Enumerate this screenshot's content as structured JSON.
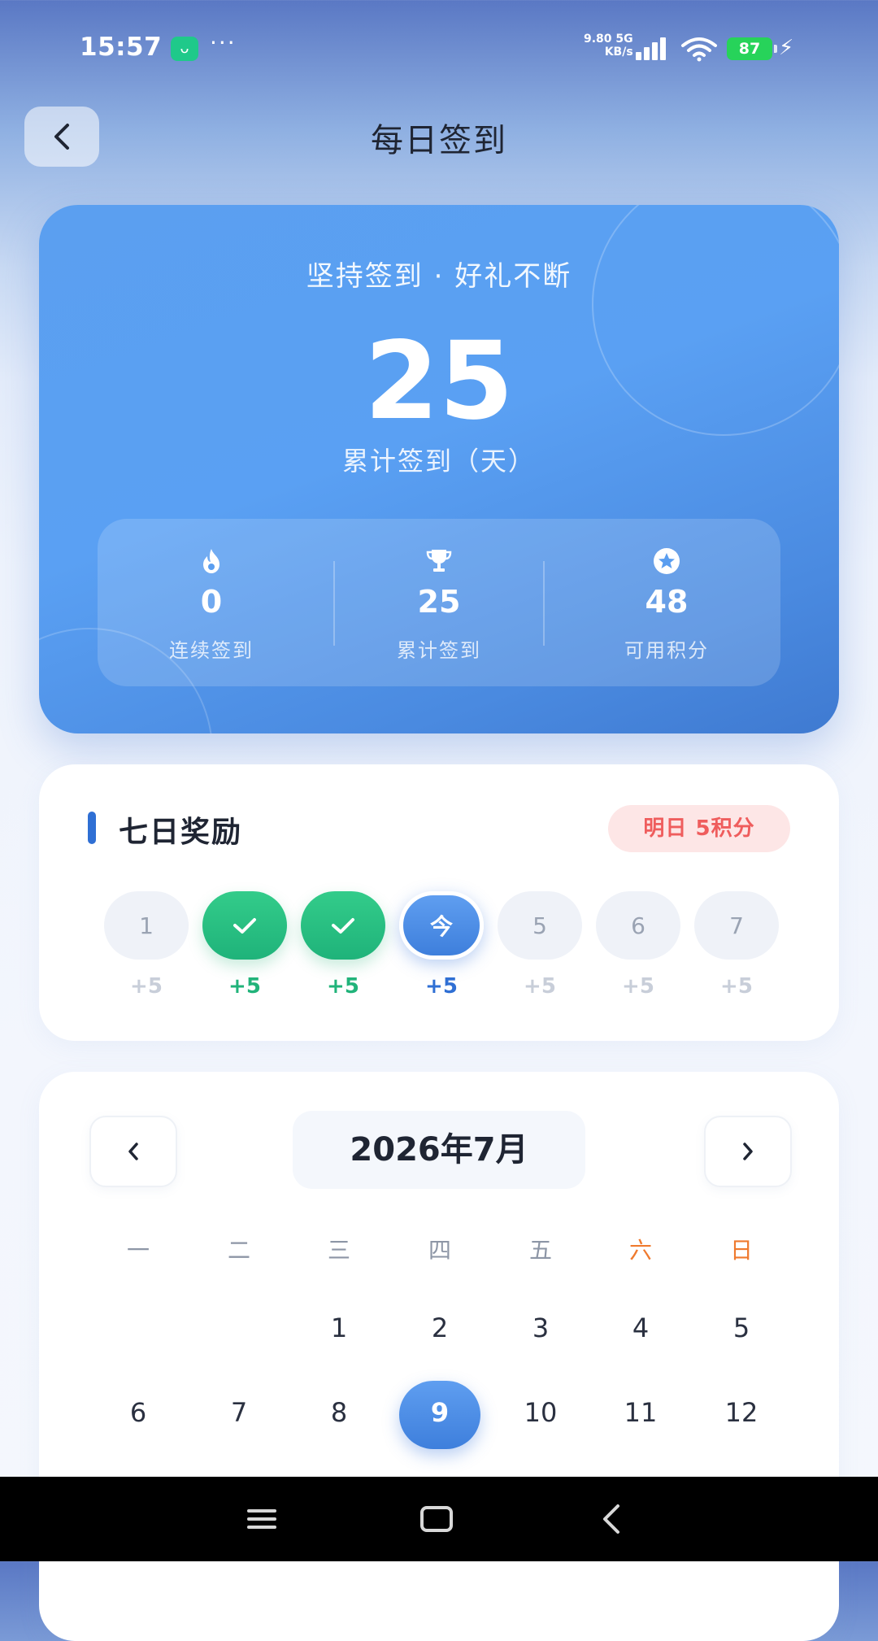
{
  "status_bar": {
    "time": "15:57",
    "app_icon": "mi-app-icon",
    "more": "···",
    "net_speed_value": "9.80 5G",
    "net_speed_unit": "KB/s",
    "battery": "87"
  },
  "header": {
    "title": "每日签到"
  },
  "hero": {
    "slogan": "坚持签到 · 好礼不断",
    "total_days": "25",
    "total_label": "累计签到（天）",
    "stats": [
      {
        "icon": "fire-icon",
        "value": "0",
        "label": "连续签到"
      },
      {
        "icon": "trophy-icon",
        "value": "25",
        "label": "累计签到"
      },
      {
        "icon": "star-badge-icon",
        "value": "48",
        "label": "可用积分"
      }
    ]
  },
  "seven_day": {
    "title": "七日奖励",
    "badge": "明日 5积分",
    "days": [
      {
        "label": "1",
        "points": "+5",
        "state": "future"
      },
      {
        "label": "",
        "points": "+5",
        "state": "done"
      },
      {
        "label": "",
        "points": "+5",
        "state": "done"
      },
      {
        "label": "今",
        "points": "+5",
        "state": "today"
      },
      {
        "label": "5",
        "points": "+5",
        "state": "future"
      },
      {
        "label": "6",
        "points": "+5",
        "state": "future"
      },
      {
        "label": "7",
        "points": "+5",
        "state": "future"
      }
    ]
  },
  "calendar": {
    "month": "2026年7月",
    "weekdays": [
      "一",
      "二",
      "三",
      "四",
      "五",
      "六",
      "日"
    ],
    "row1": [
      "",
      "",
      "1",
      "2",
      "3",
      "4",
      "5"
    ],
    "row2": [
      "6",
      "7",
      "8",
      "9",
      "10",
      "11",
      "12"
    ],
    "selected_day": "9"
  },
  "colors": {
    "accent": "#3e7fdc",
    "success": "#21b37a",
    "badge_text": "#ef5d5d",
    "weekend": "#ef7a2e"
  }
}
